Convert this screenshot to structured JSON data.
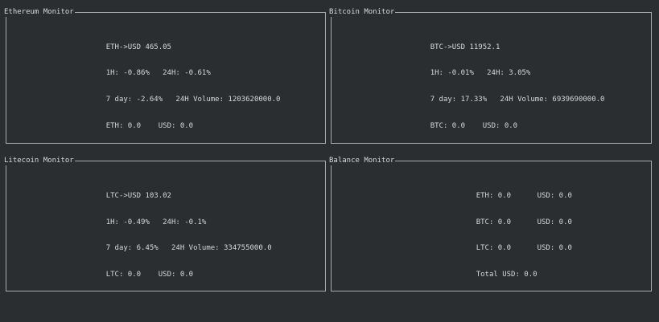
{
  "panels": {
    "eth": {
      "title": "Ethereum Monitor",
      "price": "ETH->USD 465.05",
      "change_1h": "1H: -0.86%",
      "change_24h": "24H: -0.61%",
      "change_7d": "7 day: -2.64%",
      "volume_24h": "24H Volume: 1203620000.0",
      "holding_coin": "ETH: 0.0",
      "holding_usd": "USD: 0.0"
    },
    "btc": {
      "title": "Bitcoin Monitor",
      "price": "BTC->USD 11952.1",
      "change_1h": "1H: -0.01%",
      "change_24h": "24H: 3.05%",
      "change_7d": "7 day: 17.33%",
      "volume_24h": "24H Volume: 6939690000.0",
      "holding_coin": "BTC: 0.0",
      "holding_usd": "USD: 0.0"
    },
    "ltc": {
      "title": "Litecoin Monitor",
      "price": "LTC->USD 103.02",
      "change_1h": "1H: -0.49%",
      "change_24h": "24H: -0.1%",
      "change_7d": "7 day: 6.45%",
      "volume_24h": "24H Volume: 334755000.0",
      "holding_coin": "LTC: 0.0",
      "holding_usd": "USD: 0.0"
    },
    "balance": {
      "title": "Balance Monitor",
      "rows": [
        {
          "coin": "ETH: 0.0",
          "usd": "USD: 0.0"
        },
        {
          "coin": "BTC: 0.0",
          "usd": "USD: 0.0"
        },
        {
          "coin": "LTC: 0.0",
          "usd": "USD: 0.0"
        }
      ],
      "total": "Total USD: 0.0"
    }
  }
}
